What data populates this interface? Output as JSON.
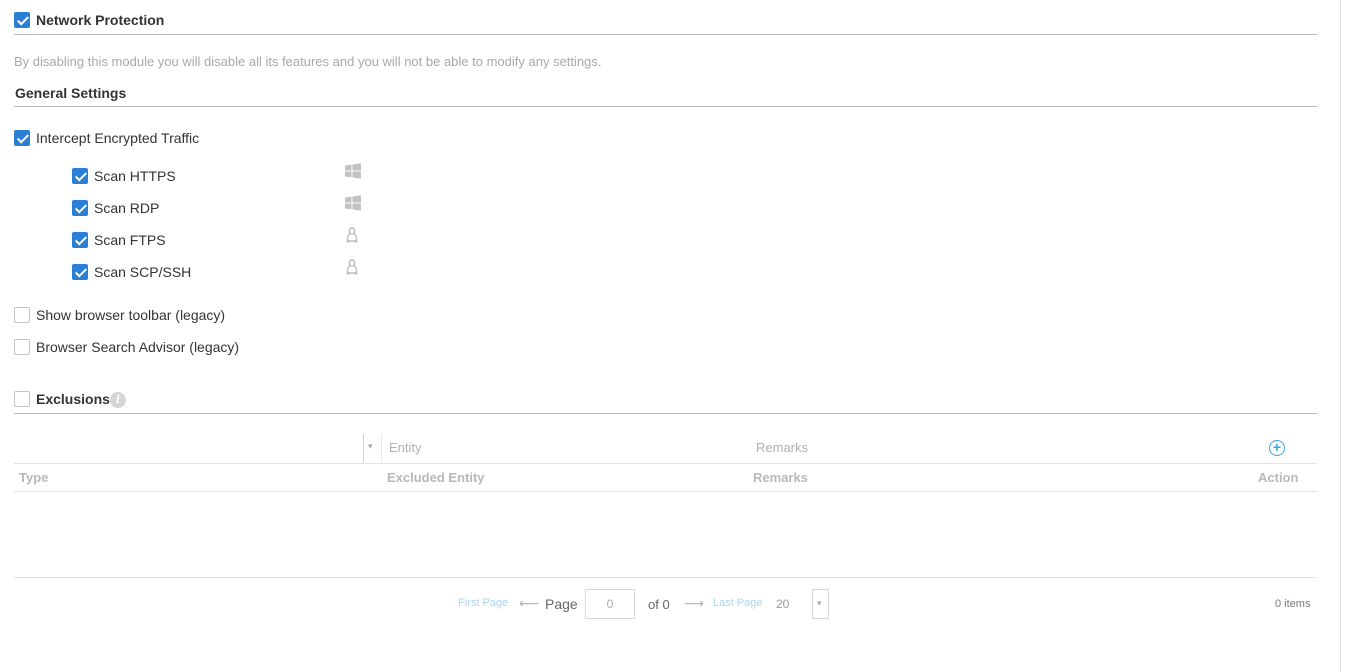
{
  "module": {
    "title": "Network Protection",
    "enabled": true,
    "description": "By disabling this module you will disable all its features and you will not be able to modify any settings."
  },
  "general_settings": {
    "title": "General Settings",
    "intercept": {
      "label": "Intercept Encrypted Traffic",
      "checked": true
    },
    "scans": [
      {
        "label": "Scan HTTPS",
        "checked": true,
        "os_icon": "windows-icon"
      },
      {
        "label": "Scan RDP",
        "checked": true,
        "os_icon": "windows-icon"
      },
      {
        "label": "Scan FTPS",
        "checked": true,
        "os_icon": "linux-icon"
      },
      {
        "label": "Scan SCP/SSH",
        "checked": true,
        "os_icon": "linux-icon"
      }
    ],
    "toolbar": {
      "label": "Show browser toolbar (legacy)",
      "checked": false
    },
    "search_advisor": {
      "label": "Browser Search Advisor (legacy)",
      "checked": false
    }
  },
  "exclusions": {
    "title": "Exclusions",
    "enabled": false,
    "info_icon": "info-icon",
    "filter": {
      "entity_placeholder": "Entity",
      "remarks_placeholder": "Remarks",
      "add_icon": "plus-circle-icon"
    },
    "columns": [
      "Type",
      "Excluded Entity",
      "Remarks",
      "Action"
    ],
    "rows": []
  },
  "pagination": {
    "first": "First Page",
    "page_label": "Page",
    "page_value": "0",
    "of": "of 0",
    "last": "Last Page",
    "page_size": "20",
    "items": "0 items"
  },
  "colors": {
    "accent": "#2b7fd4",
    "link": "#36a5e0"
  }
}
